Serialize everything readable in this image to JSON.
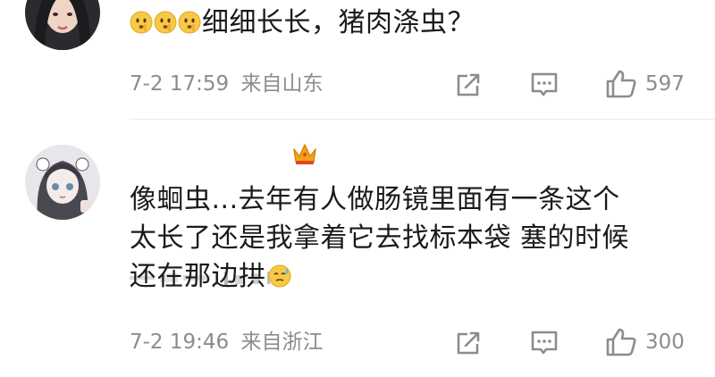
{
  "comments": [
    {
      "text": "细细长长，猪肉涤虫？",
      "emoji_icons": [
        "shushing-face-emoji",
        "shushing-face-emoji",
        "shushing-face-emoji"
      ],
      "time": "7-2 17:59",
      "location": "来自山东",
      "likes": "597",
      "avatar_icon": "user-avatar-girl-photo"
    },
    {
      "text_lines": [
        "像蛔虫...去年有人做肠镜里面有一条这个",
        "太长了还是我拿着它去找标本袋 塞的时候",
        "还在那边拱"
      ],
      "trailing_emoji": "sweat-emoji",
      "time": "7-2 19:46",
      "location": "来自浙江",
      "likes": "300",
      "avatar_icon": "user-avatar-anime-girl",
      "badge_icon": "crown-badge-icon"
    }
  ],
  "icons": {
    "share": "share-icon",
    "comment": "comment-icon",
    "like": "thumbs-up-icon"
  },
  "colors": {
    "text": "#1a1a1a",
    "meta": "#8c8c8c",
    "divider": "#ececec",
    "crown": "#f2a51a"
  }
}
